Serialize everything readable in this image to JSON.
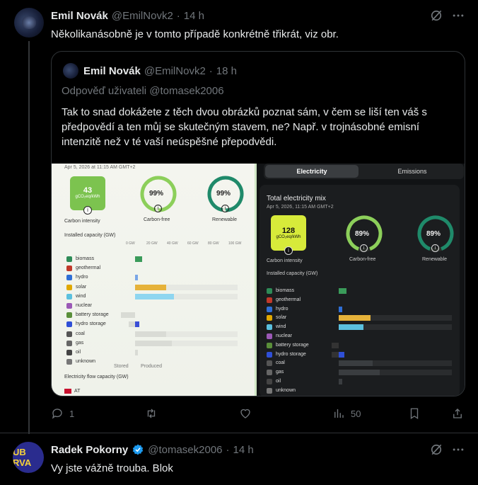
{
  "tweet": {
    "author": "Emil Novák",
    "handle": "@EmilNovk2",
    "dot": "·",
    "time": "14 h",
    "text": "Několikanásobně je v tomto případě konkrétně třikrát, viz obr."
  },
  "quote": {
    "author": "Emil Novák",
    "handle": "@EmilNovk2",
    "dot": "·",
    "time": "18 h",
    "reply_to": "Odpověď uživateli @tomasek2006",
    "text": "Tak to snad dokážete z těch dvou obrázků poznat sám, v čem se liší ten váš s předpovědí a ten můj se skutečným stavem, ne? Např. v trojnásobné emisní intenzitě než v té vaší neúspěšné přepodvědi."
  },
  "left_shot": {
    "date": "Apr 5, 2026 at 11:15 AM GMT+2",
    "carbon_value": "43",
    "carbon_unit": "gCO₂eq/kWh",
    "carbon_label": "Carbon intensity",
    "cf_value": "99%",
    "cf_label": "Carbon-free",
    "ren_value": "99%",
    "ren_label": "Renewable",
    "cap_title": "Installed capacity (GW)",
    "axis": [
      "0 GW",
      "20 GW",
      "40 GW",
      "60 GW",
      "80 GW",
      "100 GW"
    ],
    "rows": [
      "biomass",
      "geothermal",
      "hydro",
      "solar",
      "wind",
      "nuclear",
      "battery storage",
      "hydro storage",
      "coal",
      "gas",
      "oil",
      "unknown"
    ],
    "stored": "Stored",
    "produced": "Produced",
    "flow_title": "Electricity flow capacity (GW)",
    "flow_first": "AT",
    "q_mark": "?"
  },
  "right_shot": {
    "tab_electricity": "Electricity",
    "tab_emissions": "Emissions",
    "title": "Total electricity mix",
    "date": "Apr 5, 2026, 11:15 AM GMT+2",
    "carbon_value": "128",
    "carbon_unit": "gCO₂eq/kWh",
    "carbon_label": "Carbon intensity",
    "cf_value": "89%",
    "cf_label": "Carbon-free",
    "ren_value": "89%",
    "ren_label": "Renewable",
    "cap_title": "Installed capacity (GW)",
    "rows": [
      "biomass",
      "geothermal",
      "hydro",
      "solar",
      "wind",
      "nuclear",
      "battery storage",
      "hydro storage",
      "coal",
      "gas",
      "oil",
      "unknown"
    ],
    "q_mark": "?"
  },
  "actions": {
    "replies": "1",
    "views": "50"
  },
  "reply": {
    "author": "Radek Pokorny",
    "handle": "@tomasek2006",
    "dot": "·",
    "time": "14 h",
    "text": "Vy jste vážně trouba. Blok",
    "avatar_text": "UB RVA"
  },
  "colors": {
    "accent": "#1d9bf0",
    "green_gauge": "#8ccf5a",
    "teal_gauge": "#1f8a6a",
    "carbon_box": "#7cc34f",
    "carbon_box_dark": "#d7ea3a"
  }
}
